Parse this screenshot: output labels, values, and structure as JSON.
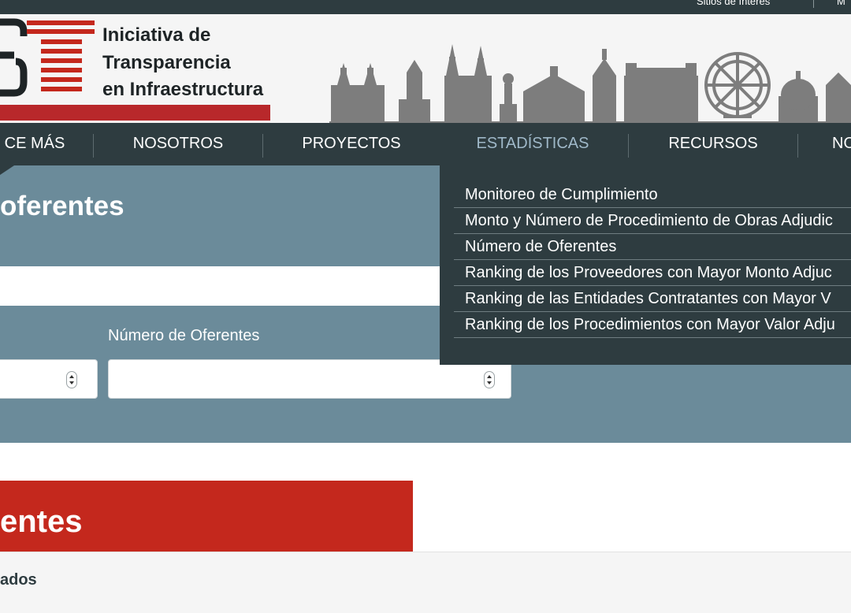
{
  "topbar": {
    "link1": "Sitios de Interés",
    "link2": "M"
  },
  "logo": {
    "title_line1": "Iniciativa de",
    "title_line2": "Transparencia",
    "title_line3": "en Infraestructura"
  },
  "nav": {
    "items": [
      {
        "label": "CE MÁS"
      },
      {
        "label": "NOSOTROS"
      },
      {
        "label": "PROYECTOS"
      },
      {
        "label": "ESTADÍSTICAS"
      },
      {
        "label": "RECURSOS"
      },
      {
        "label": "NO"
      }
    ],
    "active": "ESTADÍSTICAS"
  },
  "dropdown": {
    "items": [
      {
        "label": "Monitoreo de Cumplimiento"
      },
      {
        "label": "Monto y Número de Procedimiento de Obras Adjudic"
      },
      {
        "label": "Número de Oferentes"
      },
      {
        "label": "Ranking de los Proveedores con Mayor Monto Adjuc"
      },
      {
        "label": "Ranking de las Entidades Contratantes con Mayor V"
      },
      {
        "label": "Ranking de los Procedimientos con Mayor Valor Adju"
      }
    ]
  },
  "filter": {
    "title": "oferentes",
    "field_label": "Número de Oferentes",
    "input1_value": "",
    "input2_value": ""
  },
  "results": {
    "banner_title": "entes",
    "subtitle": "ados"
  },
  "colors": {
    "nav_bg": "#2e3c40",
    "panel_bg": "#6b8b9a",
    "brand_red": "#c4281d",
    "logo_red": "#b8282b",
    "active_nav": "#9fb8c8"
  }
}
